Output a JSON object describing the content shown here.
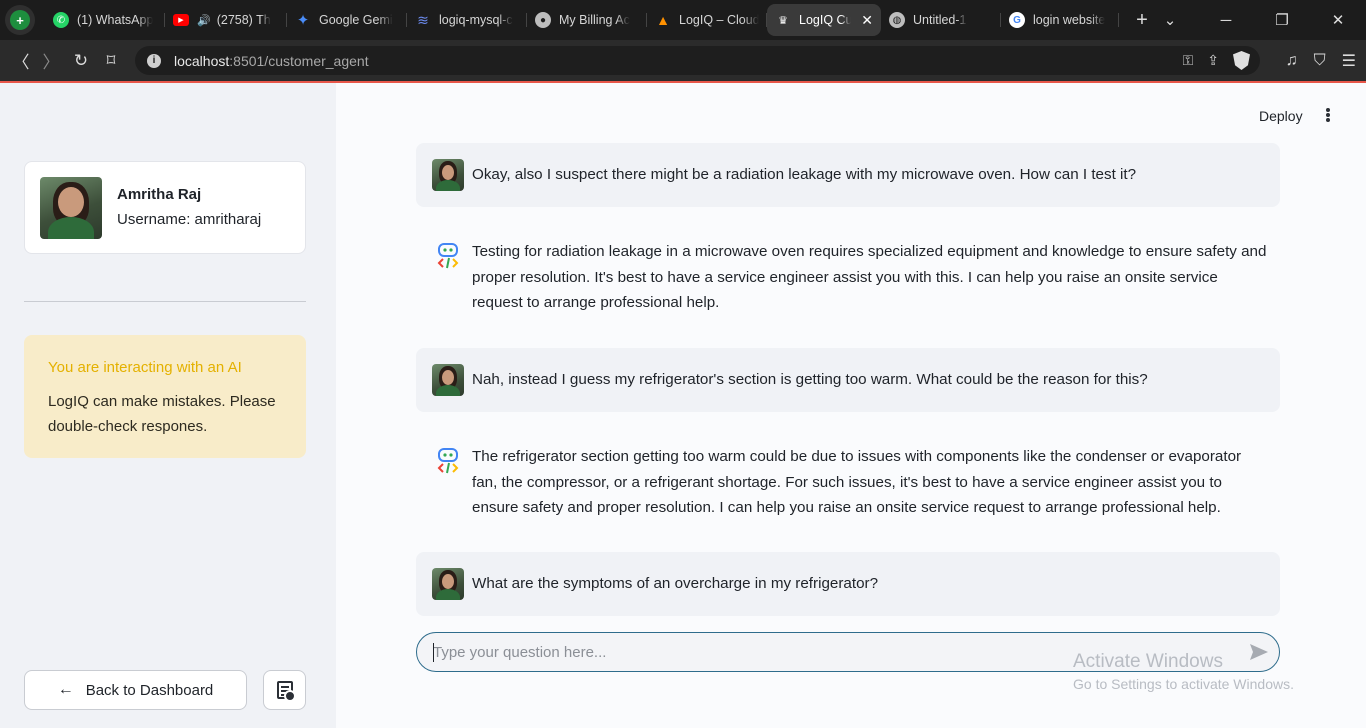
{
  "browser": {
    "tabs": [
      {
        "label": "(1) WhatsApp",
        "icon": "whatsapp-icon",
        "color": "#25d366"
      },
      {
        "label": "(2758) Th",
        "icon": "youtube-icon",
        "color": "#ff0000",
        "audio": true
      },
      {
        "label": "Google Gemi",
        "icon": "gemini-icon",
        "color": "#4a8cf7"
      },
      {
        "label": "logiq-mysql-c",
        "icon": "layers-icon",
        "color": "#6d8cf0"
      },
      {
        "label": "My Billing Ac",
        "icon": "github-icon",
        "color": "#bdbdbd"
      },
      {
        "label": "LogIQ – Cloud",
        "icon": "firebase-icon",
        "color": "#ff9100"
      },
      {
        "label": "LogIQ Cu",
        "icon": "streamlit-icon",
        "color": "#ffffff",
        "active": true
      },
      {
        "label": "Untitled-1",
        "icon": "globe-icon",
        "color": "#bdbdbd"
      },
      {
        "label": "login website",
        "icon": "google-icon",
        "color": "#ffffff"
      }
    ],
    "new_tab": "+",
    "url_host": "localhost",
    "url_rest": ":8501/customer_agent"
  },
  "sidebar": {
    "profile": {
      "name": "Amritha Raj",
      "username": "Username: amritharaj"
    },
    "notice": {
      "title": "You are interacting with an AI",
      "body": "LogIQ can make mistakes. Please double-check respones.",
      "title_color": "#e4b100",
      "bg_color": "#f8ecc9"
    },
    "back_button": "Back to Dashboard"
  },
  "header": {
    "deploy": "Deploy"
  },
  "chat": {
    "messages": [
      {
        "role": "user",
        "text": "Okay, also I suspect there might be a radiation leakage with my microwave oven. How can I test it?"
      },
      {
        "role": "assistant",
        "text": "Testing for radiation leakage in a microwave oven requires specialized equipment and knowledge to ensure safety and proper resolution. It's best to have a service engineer assist you with this. I can help you raise an onsite service request to arrange professional help."
      },
      {
        "role": "user",
        "text": "Nah, instead I guess my refrigerator's section is getting too warm. What could be the reason for this?"
      },
      {
        "role": "assistant",
        "text": "The refrigerator section getting too warm could be due to issues with components like the condenser or evaporator fan, the compressor, or a refrigerant shortage. For such issues, it's best to have a service engineer assist you to ensure safety and proper resolution. I can help you raise an onsite service request to arrange professional help."
      },
      {
        "role": "user",
        "text": "What are the symptoms of an overcharge in my refrigerator?"
      }
    ],
    "input_placeholder": "Type your question here...",
    "input_value": ""
  },
  "watermark": {
    "line1": "Activate Windows",
    "line2": "Go to Settings to activate Windows."
  },
  "colors": {
    "accent_border": "#2e6c8c",
    "header_line": "#e8574a"
  }
}
